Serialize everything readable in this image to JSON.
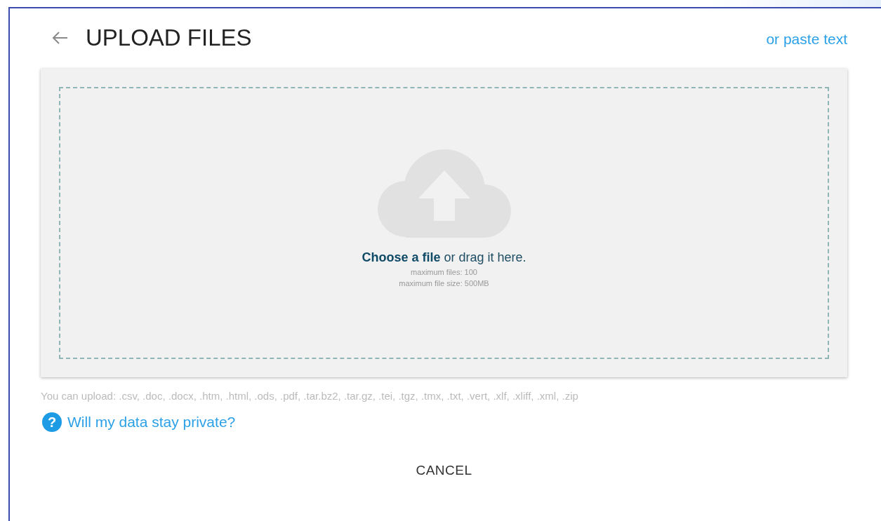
{
  "header": {
    "title": "UPLOAD FILES",
    "paste_link": "or paste text"
  },
  "dropzone": {
    "prompt": "**Choose a file** or drag it here.",
    "max_files": "maximum files: 100",
    "max_size": "maximum file size: 500MB"
  },
  "formats": "You can upload: .csv, .doc, .docx, .htm, .html, .ods, .pdf, .tar.bz2, .tar.gz, .tei, .tgz, .tmx, .txt, .vert, .xlf, .xliff, .xml, .zip",
  "privacy": {
    "icon": "?",
    "link": "Will my data stay private?"
  },
  "buttons": [
    "CANCEL"
  ]
}
